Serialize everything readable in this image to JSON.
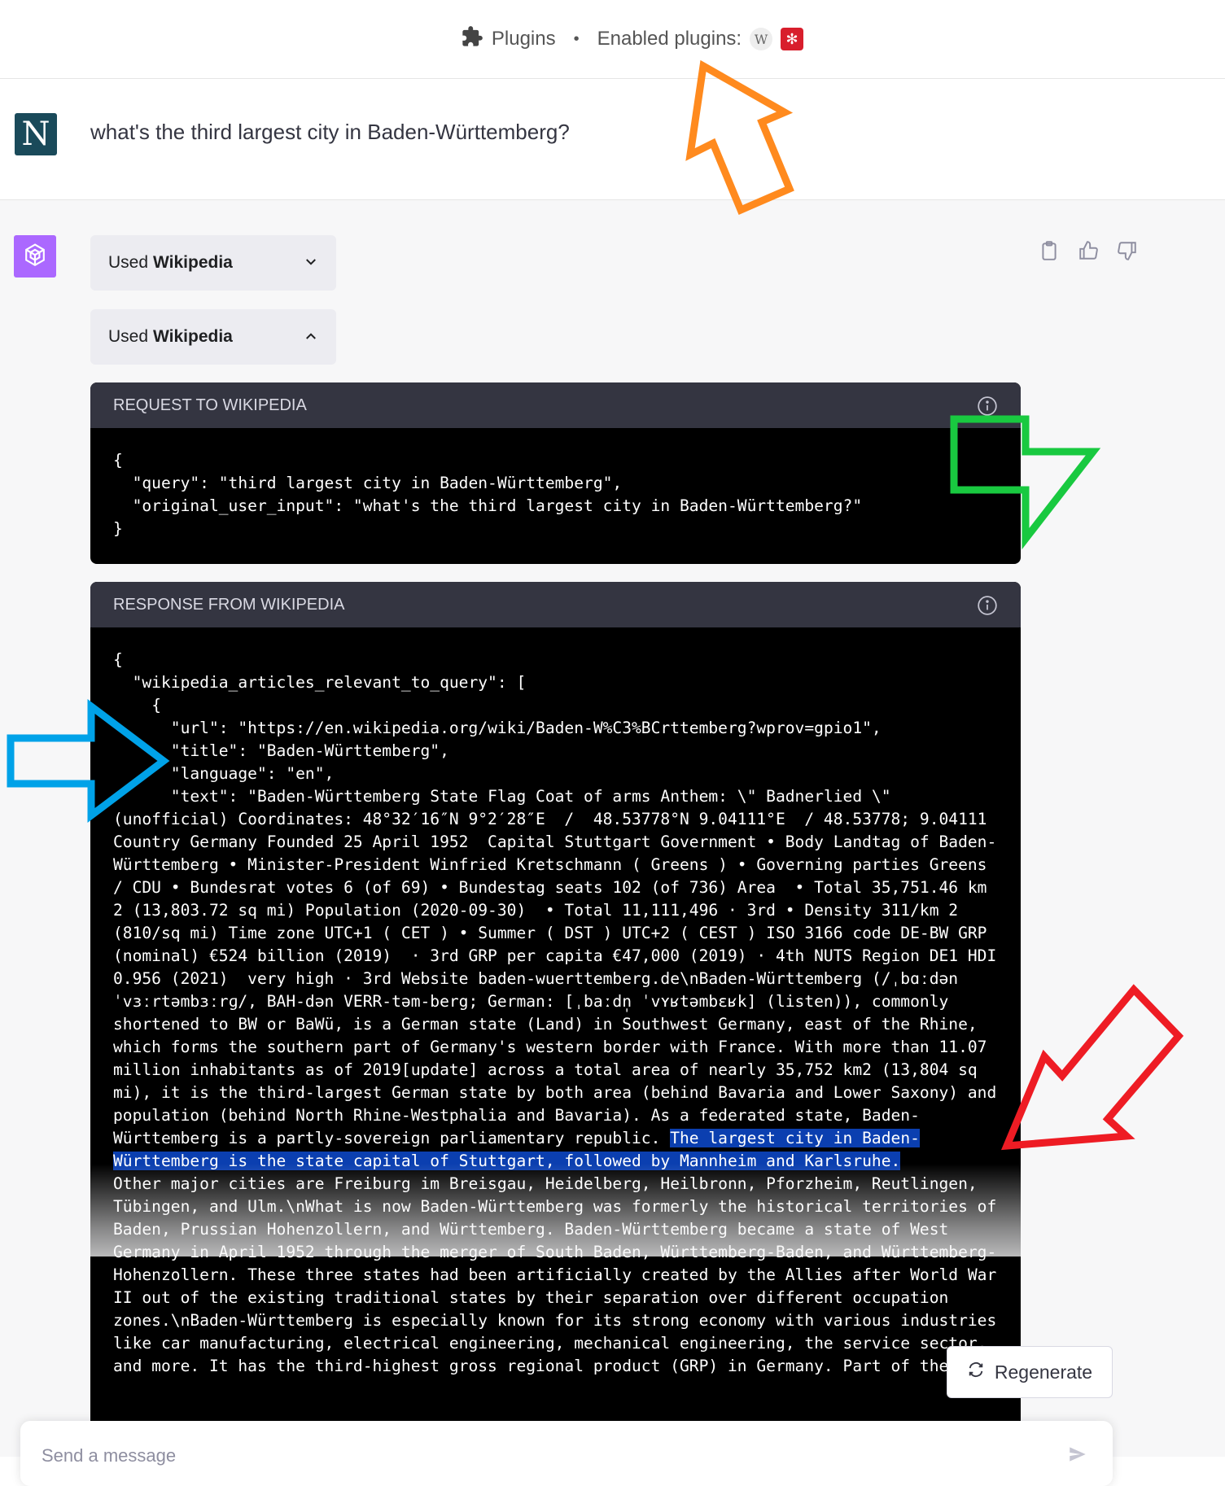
{
  "header": {
    "plugins_label": "Plugins",
    "separator": "•",
    "enabled_label": "Enabled plugins:",
    "enabled_plugins": [
      "wikipedia-icon",
      "red-plugin-icon"
    ]
  },
  "user_message": {
    "avatar_letter": "N",
    "text": "what's the third largest city in Baden-Württemberg?"
  },
  "assistant": {
    "used_buttons": [
      {
        "prefix": "Used",
        "name": "Wikipedia",
        "state": "collapsed"
      },
      {
        "prefix": "Used",
        "name": "Wikipedia",
        "state": "expanded"
      }
    ],
    "request_panel": {
      "title": "REQUEST TO WIKIPEDIA",
      "code": "{\n  \"query\": \"third largest city in Baden-Württemberg\",\n  \"original_user_input\": \"what's the third largest city in Baden-Württemberg?\"\n}"
    },
    "response_panel": {
      "title": "RESPONSE FROM WIKIPEDIA",
      "code_before": "{\n  \"wikipedia_articles_relevant_to_query\": [\n    {\n      \"url\": \"https://en.wikipedia.org/wiki/Baden-W%C3%BCrttemberg?wprov=gpio1\",\n      \"title\": \"Baden-Württemberg\",\n      \"language\": \"en\",\n      \"text\": \"Baden-Württemberg State Flag Coat of arms Anthem: \\\" Badnerlied \\\" (unofficial) Coordinates: 48°32′16″N 9°2′28″E  /  48.53778°N 9.04111°E  / 48.53778; 9.04111 Country Germany Founded 25 April 1952  Capital Stuttgart Government • Body Landtag of Baden-Württemberg • Minister-President Winfried Kretschmann ( Greens ) • Governing parties Greens / CDU • Bundesrat votes 6 (of 69) • Bundestag seats 102 (of 736) Area  • Total 35,751.46 km 2 (13,803.72 sq mi) Population (2020-09-30)  • Total 11,111,496 · 3rd • Density 311/km 2 (810/sq mi) Time zone UTC+1 ( CET ) • Summer ( DST ) UTC+2 ( CEST ) ISO 3166 code DE-BW GRP (nominal) €524 billion (2019)  · 3rd GRP per capita €47,000 (2019) · 4th NUTS Region DE1 HDI 0.956 (2021)  very high · 3rd Website baden-wuerttemberg.de\\nBaden-Württemberg (/ˌbɑːdən ˈvɜːrtəmbɜːrɡ/, BAH-dən VERR-təm-berg; German: [ˌbaːdn̩ ˈvʏʁtəmbɛʁk] (listen)), commonly shortened to BW or BaWü, is a German state (Land) in Southwest Germany, east of the Rhine, which forms the southern part of Germany's western border with France. With more than 11.07 million inhabitants as of 2019[update] across a total area of nearly 35,752 km2 (13,804 sq mi), it is the third-largest German state by both area (behind Bavaria and Lower Saxony) and population (behind North Rhine-Westphalia and Bavaria). As a federated state, Baden-Württemberg is a partly-sovereign parliamentary republic. ",
      "code_highlight": "The largest city in Baden-Württemberg is the state capital of Stuttgart, followed by Mannheim and Karlsruhe.",
      "code_after": "\nOther major cities are Freiburg im Breisgau, Heidelberg, Heilbronn, Pforzheim, Reutlingen, Tübingen, and Ulm.\\nWhat is now Baden-Württemberg was formerly the historical territories of Baden, Prussian Hohenzollern, and Württemberg. Baden-Württemberg became a state of West Germany in April 1952 through the merger of South Baden, Württemberg-Baden, and Württemberg-Hohenzollern. These three states had been artificially created by the Allies after World War II out of the existing traditional states by their separation over different occupation zones.\\nBaden-Württemberg is especially known for its strong economy with various industries like car manufacturing, electrical engineering, mechanical engineering, the service sector, and more. It has the third-highest gross regional product (GRP) in Germany. Part of the"
    },
    "regenerate_label": "Regenerate",
    "input_placeholder": "Send a message"
  },
  "annotation_colors": {
    "orange": "#ff8a1e",
    "green": "#19c940",
    "blue": "#00a2e8",
    "red": "#ee1c24"
  }
}
